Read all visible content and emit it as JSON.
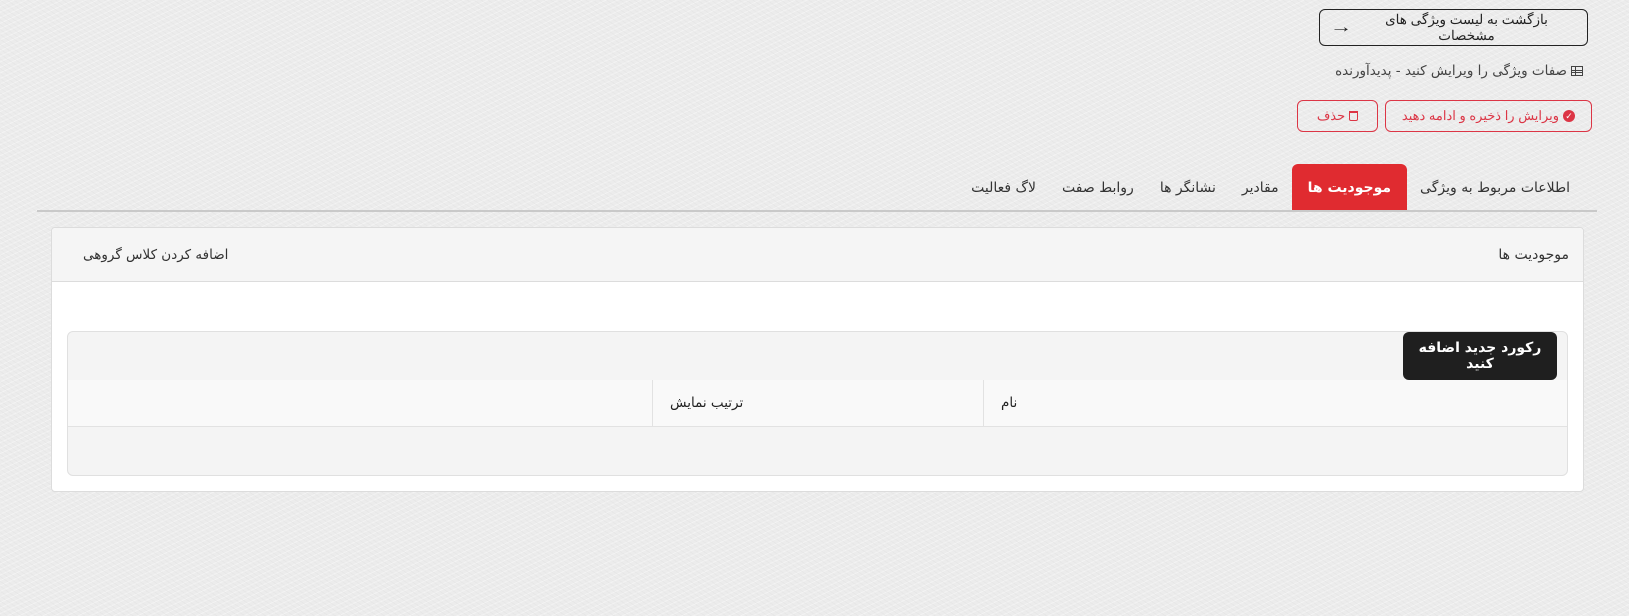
{
  "header": {
    "back_label": "بازگشت به لیست ویژگی های مشخصات",
    "back_arrow": "→",
    "subtitle": "صفات ویژگی را ویرایش کنید - پدیدآورنده"
  },
  "actions": {
    "save_continue_label": "ویرایش را ذخیره و ادامه دهید",
    "delete_label": "حذف"
  },
  "tabs": [
    {
      "label": "اطلاعات مربوط به ویژگی",
      "active": false
    },
    {
      "label": "موجودیت ها",
      "active": true
    },
    {
      "label": "مقادیر",
      "active": false
    },
    {
      "label": "نشانگر ها",
      "active": false
    },
    {
      "label": "روابط صفت",
      "active": false
    },
    {
      "label": "لاگ فعالیت",
      "active": false
    }
  ],
  "card": {
    "title": "موجودیت ها",
    "add_group_label": "اضافه کردن کلاس گروهی",
    "add_record_label": "رکورد جدید اضافه کنید",
    "columns": [
      "نام",
      "ترتیب نمایش",
      ""
    ]
  },
  "colors": {
    "accent": "#e02b30",
    "outline_red": "#dc3545",
    "dark_button": "#1f1f1f",
    "background": "#ececec"
  }
}
